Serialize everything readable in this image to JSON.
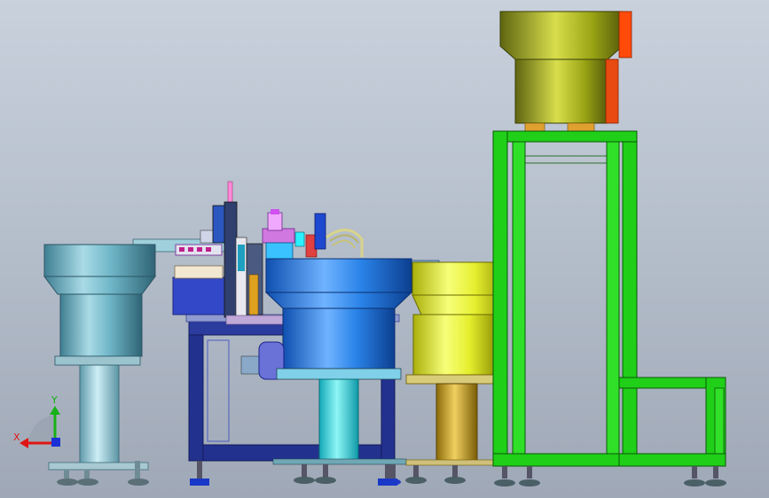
{
  "viewport": {
    "background_top": "#c9d1dd",
    "background_bottom": "#9fa8b6"
  },
  "triad": {
    "x_label": "X",
    "y_label": "Y",
    "x_color": "#e01616",
    "y_color": "#18b018",
    "z_color": "#1b2fd6"
  },
  "colors": {
    "green_frame": "#1fcf18",
    "olive_hopper": "#9aa414",
    "orange_accent": "#ff4a0a",
    "yellow_bowl": "#e5ef2e",
    "blue_bowl": "#2a83e8",
    "cyan_column": "#2ee0e0",
    "navy_frame": "#23318e",
    "teal_bowl": "#6fb6c8",
    "gold_column": "#c8a018"
  }
}
